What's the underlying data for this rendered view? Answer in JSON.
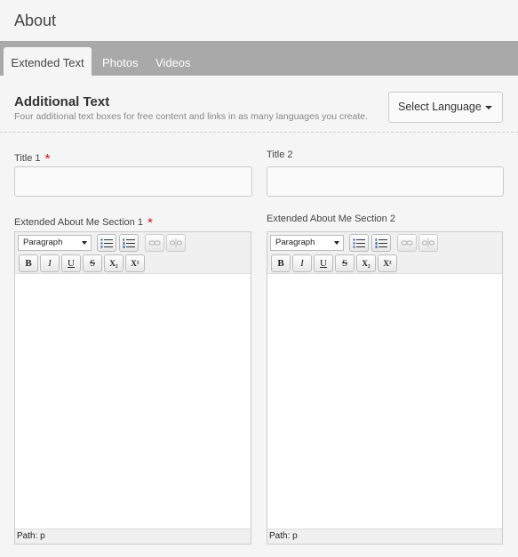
{
  "header": {
    "title": "About"
  },
  "tabs": [
    {
      "label": "Extended Text",
      "active": true
    },
    {
      "label": "Photos",
      "active": false
    },
    {
      "label": "Videos",
      "active": false
    }
  ],
  "section": {
    "heading": "Additional Text",
    "description": "Four additional text boxes for free content and links in as many languages you create."
  },
  "language_select": {
    "label": "Select Language"
  },
  "fields": {
    "title1": {
      "label": "Title 1",
      "required_mark": "*",
      "value": ""
    },
    "title2": {
      "label": "Title 2",
      "value": ""
    },
    "section1": {
      "label": "Extended About Me Section 1",
      "required_mark": "*"
    },
    "section2": {
      "label": "Extended About Me Section 2"
    }
  },
  "editor": {
    "format_value": "Paragraph",
    "path_text": "Path: p",
    "buttons": {
      "bold": "B",
      "italic": "I",
      "underline": "U",
      "strike": "S",
      "subscript": "X₂",
      "superscript": "X²"
    }
  },
  "colors": {
    "tab_bar": "#a9a9a9",
    "required": "#dd1111",
    "background": "#f5f5f5"
  }
}
